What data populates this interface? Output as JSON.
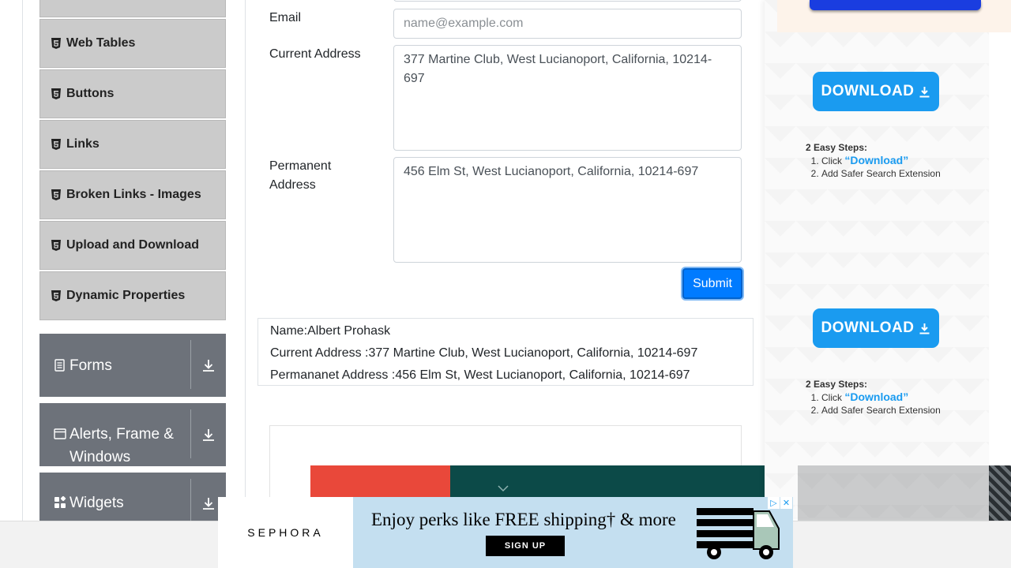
{
  "sidebar": {
    "items": [
      {
        "label": "Web Tables"
      },
      {
        "label": "Buttons"
      },
      {
        "label": "Links"
      },
      {
        "label": "Broken Links - Images"
      },
      {
        "label": "Upload and Download"
      },
      {
        "label": "Dynamic Properties"
      }
    ],
    "groups": [
      {
        "label": "Forms",
        "icon": "document-icon"
      },
      {
        "label": "Alerts, Frame & Windows",
        "icon": "window-icon"
      },
      {
        "label": "Widgets",
        "icon": "widgets-icon"
      }
    ]
  },
  "form": {
    "email_label": "Email",
    "email_placeholder": "name@example.com",
    "current_address_label": "Current Address",
    "current_address_value": "377 Martine Club, West Lucianoport, California, 10214-697",
    "permanent_address_label": "Permanent Address",
    "permanent_address_value": "456 Elm St, West Lucianoport, California, 10214-697",
    "submit_label": "Submit"
  },
  "output": {
    "name": "Name:Albert Prohask",
    "current_address": "Current Address :377 Martine Club, West Lucianoport, California, 10214-697",
    "permanent_address": "Permananet Address :456 Elm St, West Lucianoport, California, 10214-697"
  },
  "right_ad": {
    "download_label": "DOWNLOAD",
    "steps_title": "2 Easy Steps:",
    "step1_prefix": "Click ",
    "step1_link": "“Download”",
    "step2": "Add Safer Search Extension"
  },
  "banner": {
    "brand": "SEPHORA",
    "headline": "Enjoy perks like FREE shipping† & more",
    "cta": "SIGN UP"
  }
}
